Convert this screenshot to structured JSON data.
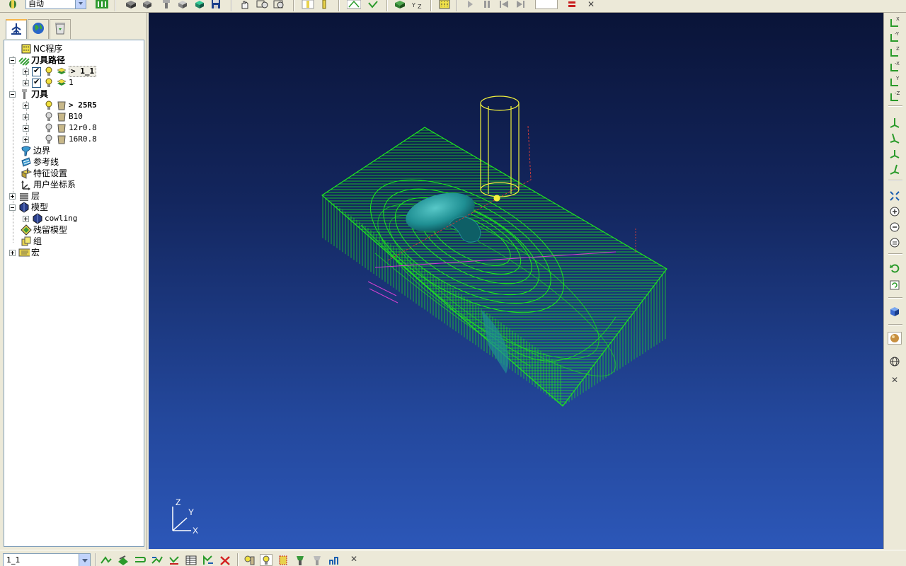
{
  "top_toolbar": {
    "mode_select_value": "自动",
    "frame_input_value": "",
    "icons": [
      "app-icon",
      "nc-toolbar-icon",
      "stock-icon",
      "block-icon",
      "tool-icon",
      "model-icon",
      "import-icon",
      "save-icon",
      "pan-icon",
      "zoom-box-icon",
      "rotate-icon",
      "toolpath-display-icon",
      "cutter-icon",
      "leads-icon",
      "tick-icon",
      "simulation-icon",
      "workplane-icon",
      "nc-grid-icon",
      "play-icon",
      "pause-icon",
      "rewind-icon",
      "step-icon",
      "stop-icon",
      "close-icon"
    ]
  },
  "explorer": {
    "tabs": [
      {
        "name": "explorer-tab-icon",
        "active": true
      },
      {
        "name": "globe-tab-icon",
        "active": false
      },
      {
        "name": "recycle-bin-tab-icon",
        "active": false
      }
    ],
    "tree": [
      {
        "label": "NC程序",
        "bold": false
      },
      {
        "label": "刀具路径",
        "bold": true
      },
      {
        "label": "> 1_1",
        "bold": true
      },
      {
        "label": "1",
        "bold": false
      },
      {
        "label": "刀具",
        "bold": true
      },
      {
        "label": "> 25R5",
        "bold": true
      },
      {
        "label": "B10",
        "bold": false
      },
      {
        "label": "12r0.8",
        "bold": false
      },
      {
        "label": "16R0.8",
        "bold": false
      },
      {
        "label": "边界",
        "bold": false
      },
      {
        "label": "参考线",
        "bold": false
      },
      {
        "label": "特征设置",
        "bold": false
      },
      {
        "label": "用户坐标系",
        "bold": false
      },
      {
        "label": "层",
        "bold": false
      },
      {
        "label": "模型",
        "bold": false
      },
      {
        "label": "cowling",
        "bold": false
      },
      {
        "label": "残留模型",
        "bold": false
      },
      {
        "label": "组",
        "bold": false
      },
      {
        "label": "宏",
        "bold": false
      }
    ]
  },
  "viewport": {
    "axis_labels": {
      "z": "Z",
      "y": "Y",
      "x": "X"
    },
    "colors": {
      "toolpath": "#1ee61e",
      "model": "#1f8f93",
      "tool": "#f0f03c",
      "rapid": "#c83c3c",
      "link": "#d040d0",
      "background_top": "#0a1438",
      "background_bottom": "#2c57b8"
    }
  },
  "right_toolbar": {
    "icons": [
      "view-x-icon",
      "view-minus-y-icon",
      "view-z-icon",
      "view-minus-x-icon",
      "view-y-icon",
      "view-minus-z-icon",
      "iso1-icon",
      "iso2-icon",
      "iso3-icon",
      "iso4-icon",
      "zoom-fit-icon",
      "zoom-in-icon",
      "zoom-out-icon",
      "zoom-previous-icon",
      "undo-view-icon",
      "refresh-icon",
      "shaded-cube-icon",
      "shading-sphere-icon",
      "wireframe-globe-icon",
      "close-icon"
    ]
  },
  "bottom_toolbar": {
    "toolpath_select_value": "1_1",
    "icons": [
      "toolpath-strategy-icon",
      "toolpath-edit-icon",
      "leads-links-icon",
      "feedrate-icon",
      "verify-icon",
      "table-icon",
      "transform-icon",
      "delete-icon",
      "tool-display-icon",
      "active-tool-icon",
      "shank-icon",
      "holder-icon",
      "tool-db-icon",
      "tool-measure-icon",
      "close-icon"
    ]
  }
}
